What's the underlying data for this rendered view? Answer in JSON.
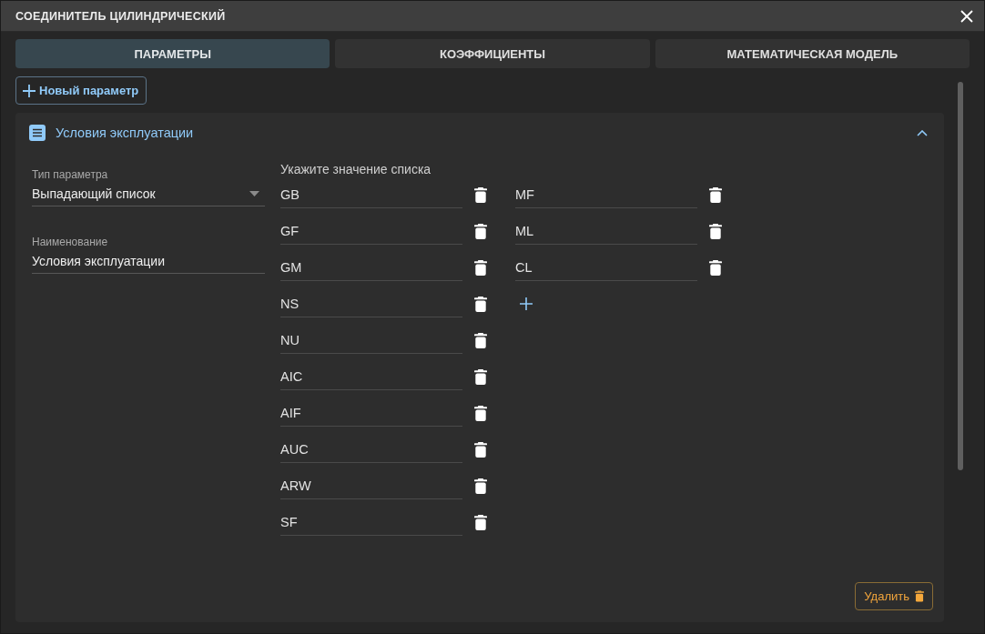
{
  "window": {
    "title": "СОЕДИНИТЕЛЬ ЦИЛИНДРИЧЕСКИЙ"
  },
  "tabs": [
    {
      "label": "ПАРАМЕТРЫ",
      "selected": true
    },
    {
      "label": "КОЭФФИЦИЕНТЫ",
      "selected": false
    },
    {
      "label": "МАТЕМАТИЧЕСКАЯ МОДЕЛЬ",
      "selected": false
    }
  ],
  "new_parameter_button": {
    "label": "Новый параметр"
  },
  "parameter": {
    "title": "Условия эксплуатации",
    "expanded": true,
    "fields": [
      {
        "kind": "select",
        "label": "Тип параметра",
        "value": "Выпадающий список"
      },
      {
        "kind": "text",
        "label": "Наименование",
        "value": "Условия эксплуатации"
      }
    ],
    "list_values": {
      "label": "Укажите значение списка",
      "columns": [
        {
          "values": [
            "GB",
            "GF",
            "GM",
            "NS",
            "NU",
            "AIC",
            "AIF",
            "AUC",
            "ARW",
            "SF"
          ]
        },
        {
          "values": [
            "MF",
            "ML",
            "CL"
          ]
        }
      ]
    },
    "delete_button": {
      "label": "Удалить"
    }
  }
}
